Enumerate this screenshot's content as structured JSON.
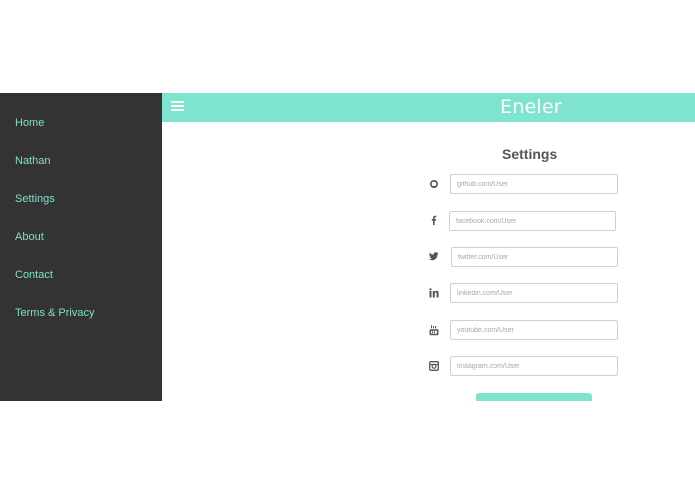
{
  "app": {
    "title": "Eneler"
  },
  "sidebar": {
    "items": [
      {
        "label": "Home"
      },
      {
        "label": "Nathan"
      },
      {
        "label": "Settings"
      },
      {
        "label": "About"
      },
      {
        "label": "Contact"
      },
      {
        "label": "Terms & Privacy"
      }
    ]
  },
  "settings": {
    "title": "Settings",
    "fields": [
      {
        "icon": "github-icon",
        "placeholder": "github.com/User"
      },
      {
        "icon": "facebook-icon",
        "placeholder": "facebook.com/User"
      },
      {
        "icon": "twitter-icon",
        "placeholder": "twitter.com/User"
      },
      {
        "icon": "linkedin-icon",
        "placeholder": "linkedin.com/User"
      },
      {
        "icon": "youtube-icon",
        "placeholder": "youtube.com/User"
      },
      {
        "icon": "instagram-icon",
        "placeholder": "instagram.com/User"
      }
    ]
  },
  "colors": {
    "accent": "#7ee3cf",
    "sidebar_bg": "#333333",
    "sidebar_text": "#7fe0cc"
  }
}
